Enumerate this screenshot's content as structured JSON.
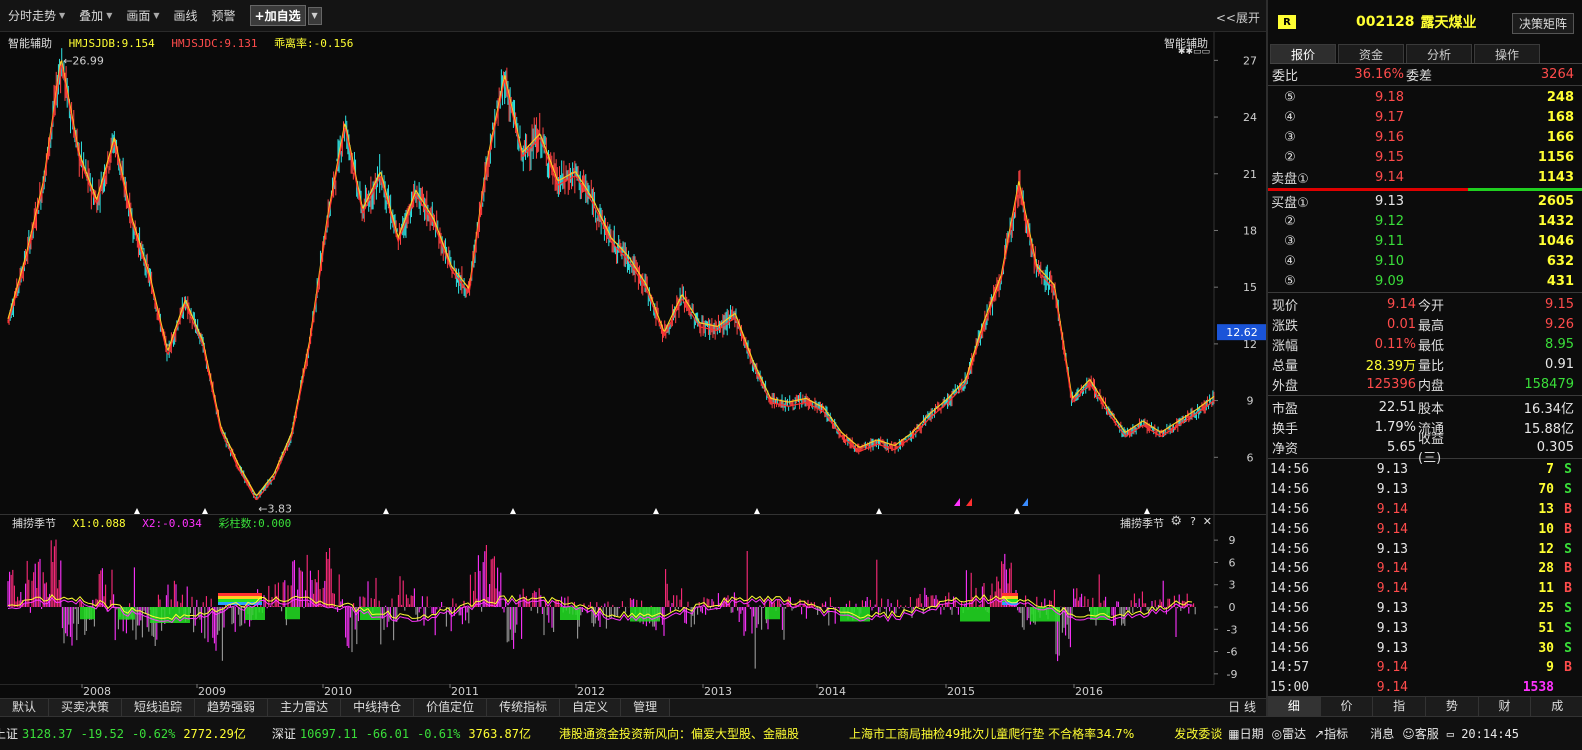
{
  "toolbar": {
    "items": [
      "分时走势",
      "叠加",
      "画面",
      "画线",
      "预警"
    ],
    "add_favorite": "+加自选",
    "expand": "<<展开"
  },
  "main_legend": {
    "indicator": "智能辅助",
    "hmjsjdb": "HMJSJDB:9.154",
    "hmjsjdc": "HMJSJDC:9.131",
    "deviation": "乖离率:-0.156",
    "right_label": "智能辅助",
    "right_sub": "✱✱▭▭"
  },
  "osc_legend": {
    "indicator": "捕捞季节",
    "x1": "X1:0.088",
    "x2": "X2:-0.034",
    "bars": "彩柱数:0.000",
    "right_label": "捕捞季节",
    "help": "?",
    "close": "✕"
  },
  "chart_data": [
    {
      "type": "line",
      "name": "price",
      "x_labels": [
        "2008",
        "2009",
        "2010",
        "2011",
        "2012",
        "2013",
        "2014",
        "2015",
        "2016"
      ],
      "y_ticks": [
        6,
        9,
        12,
        15,
        18,
        21,
        24,
        27
      ],
      "ylim": [
        3,
        28.5
      ],
      "current_price_tag": "12.62",
      "current_price_value": 12.62,
      "max_label": "26.99",
      "min_label": "3.83",
      "series": [
        {
          "values": [
            13.2,
            16.5,
            20.5,
            26.99,
            22.0,
            19.5,
            22.8,
            18.5,
            15.5,
            11.5,
            14.2,
            12.0,
            7.5,
            5.5,
            3.83,
            5.0,
            7.2,
            12.0,
            18.5,
            23.6,
            19.0,
            21.0,
            17.5,
            20.0,
            18.5,
            16.0,
            14.8,
            21.5,
            26.1,
            22.0,
            23.0,
            20.5,
            21.0,
            19.5,
            17.5,
            16.5,
            15.0,
            12.5,
            14.5,
            13.0,
            12.8,
            13.5,
            11.0,
            9.0,
            8.8,
            9.0,
            8.5,
            7.2,
            6.4,
            6.8,
            6.5,
            7.2,
            8.2,
            9.0,
            10.0,
            13.0,
            15.5,
            20.5,
            16.0,
            15.0,
            9.0,
            10.0,
            8.5,
            7.2,
            7.8,
            7.2,
            7.8,
            8.4,
            9.1
          ]
        }
      ]
    },
    {
      "type": "bar",
      "name": "oscillator",
      "y_ticks": [
        9,
        6,
        3,
        0,
        -3,
        -6,
        -9
      ],
      "ylim": [
        -10.5,
        10.5
      ]
    }
  ],
  "bottom_tabs": [
    "默认",
    "买卖决策",
    "短线追踪",
    "趋势强弱",
    "主力雷达",
    "中线持仓",
    "价值定位",
    "传统指标",
    "自定义",
    "管理"
  ],
  "period": "日 线",
  "status": {
    "sh_name": "上证",
    "sh_index": "3128.37",
    "sh_change": "-19.52",
    "sh_pct": "-0.62%",
    "sh_amount": "2772.29亿",
    "sz_name": "深证",
    "sz_index": "10697.11",
    "sz_change": "-66.01",
    "sz_pct": "-0.61%",
    "sz_amount": "3763.87亿",
    "news1": "港股通资金投资新风向：偏爱大型股、金融股",
    "news2": "上海市工商局抽检49批次儿童爬行垫 不合格率34.7%",
    "news3": "发改委谈",
    "calendar": "日期",
    "radar": "雷达",
    "indicator": "指标",
    "message": "消息",
    "service": "客服",
    "time": "20:14:45"
  },
  "stock": {
    "badge": "R",
    "code": "002128",
    "name": "露天煤业",
    "decision_button": "决策矩阵",
    "tabs": [
      "报价",
      "资金",
      "分析",
      "操作"
    ],
    "ratio_label": "委比",
    "ratio": "36.16%",
    "diff_label": "委差",
    "diff": "3264",
    "sell": [
      {
        "lvl": "⑤",
        "price": "9.18",
        "vol": "248"
      },
      {
        "lvl": "④",
        "price": "9.17",
        "vol": "168"
      },
      {
        "lvl": "③",
        "price": "9.16",
        "vol": "166"
      },
      {
        "lvl": "②",
        "price": "9.15",
        "vol": "1156"
      },
      {
        "lvl": "卖盘①",
        "price": "9.14",
        "vol": "1143"
      }
    ],
    "buy": [
      {
        "lvl": "买盘①",
        "price": "9.13",
        "vol": "2605"
      },
      {
        "lvl": "②",
        "price": "9.12",
        "vol": "1432"
      },
      {
        "lvl": "③",
        "price": "9.11",
        "vol": "1046"
      },
      {
        "lvl": "④",
        "price": "9.10",
        "vol": "632"
      },
      {
        "lvl": "⑤",
        "price": "9.09",
        "vol": "431"
      }
    ],
    "quote": [
      {
        "k1": "现价",
        "v1": "9.14",
        "c1": "red",
        "k2": "今开",
        "v2": "9.15",
        "c2": "red"
      },
      {
        "k1": "涨跌",
        "v1": "0.01",
        "c1": "red",
        "k2": "最高",
        "v2": "9.26",
        "c2": "red"
      },
      {
        "k1": "涨幅",
        "v1": "0.11%",
        "c1": "red",
        "k2": "最低",
        "v2": "8.95",
        "c2": "green"
      },
      {
        "k1": "总量",
        "v1": "28.39万",
        "c1": "yellow",
        "k2": "量比",
        "v2": "0.91",
        "c2": "white"
      },
      {
        "k1": "外盘",
        "v1": "125396",
        "c1": "red",
        "k2": "内盘",
        "v2": "158479",
        "c2": "green"
      }
    ],
    "fundamentals": [
      {
        "k1": "市盈",
        "v1": "22.51",
        "k2": "股本",
        "v2": "16.34亿"
      },
      {
        "k1": "换手",
        "v1": "1.79%",
        "k2": "流通",
        "v2": "15.88亿"
      },
      {
        "k1": "净资",
        "v1": "5.65",
        "k2": "收益(三)",
        "v2": "0.305"
      }
    ],
    "ticks": [
      {
        "t": "14:56",
        "p": "9.13",
        "pc": "white",
        "v": "7",
        "d": "S"
      },
      {
        "t": "14:56",
        "p": "9.13",
        "pc": "white",
        "v": "70",
        "d": "S"
      },
      {
        "t": "14:56",
        "p": "9.14",
        "pc": "red",
        "v": "13",
        "d": "B"
      },
      {
        "t": "14:56",
        "p": "9.14",
        "pc": "red",
        "v": "10",
        "d": "B"
      },
      {
        "t": "14:56",
        "p": "9.13",
        "pc": "white",
        "v": "12",
        "d": "S"
      },
      {
        "t": "14:56",
        "p": "9.14",
        "pc": "red",
        "v": "28",
        "d": "B"
      },
      {
        "t": "14:56",
        "p": "9.14",
        "pc": "red",
        "v": "11",
        "d": "B"
      },
      {
        "t": "14:56",
        "p": "9.13",
        "pc": "white",
        "v": "25",
        "d": "S"
      },
      {
        "t": "14:56",
        "p": "9.13",
        "pc": "white",
        "v": "51",
        "d": "S"
      },
      {
        "t": "14:56",
        "p": "9.13",
        "pc": "white",
        "v": "30",
        "d": "S"
      },
      {
        "t": "14:57",
        "p": "9.14",
        "pc": "red",
        "v": "9",
        "d": "B"
      },
      {
        "t": "15:00",
        "p": "9.14",
        "pc": "red",
        "v": "1538",
        "d": ""
      }
    ],
    "bottom_tabs": [
      "细",
      "价",
      "指",
      "势",
      "财",
      "成"
    ]
  }
}
